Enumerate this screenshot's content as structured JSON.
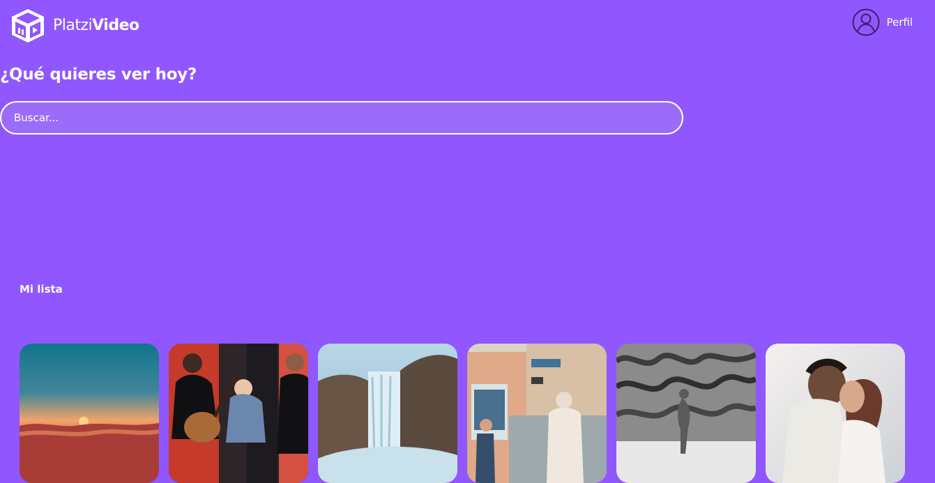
{
  "app": {
    "logo_text_light": "Platzi",
    "logo_text_bold": "Video",
    "brand_color": "#8f57fd"
  },
  "header": {
    "profile_label": "Perfil",
    "profile_icon": "user-circle-icon"
  },
  "hero": {
    "title": "¿Qué quieres ver hoy?"
  },
  "search": {
    "placeholder": "Buscar...",
    "value": ""
  },
  "my_list": {
    "title": "Mi lista",
    "items": [
      {
        "thumbnail": "sunset-sea"
      },
      {
        "thumbnail": "band-with-guitar"
      },
      {
        "thumbnail": "waterfall"
      },
      {
        "thumbnail": "city-street-officer"
      },
      {
        "thumbnail": "underwater-swimmer"
      },
      {
        "thumbnail": "couple-embrace"
      }
    ]
  }
}
